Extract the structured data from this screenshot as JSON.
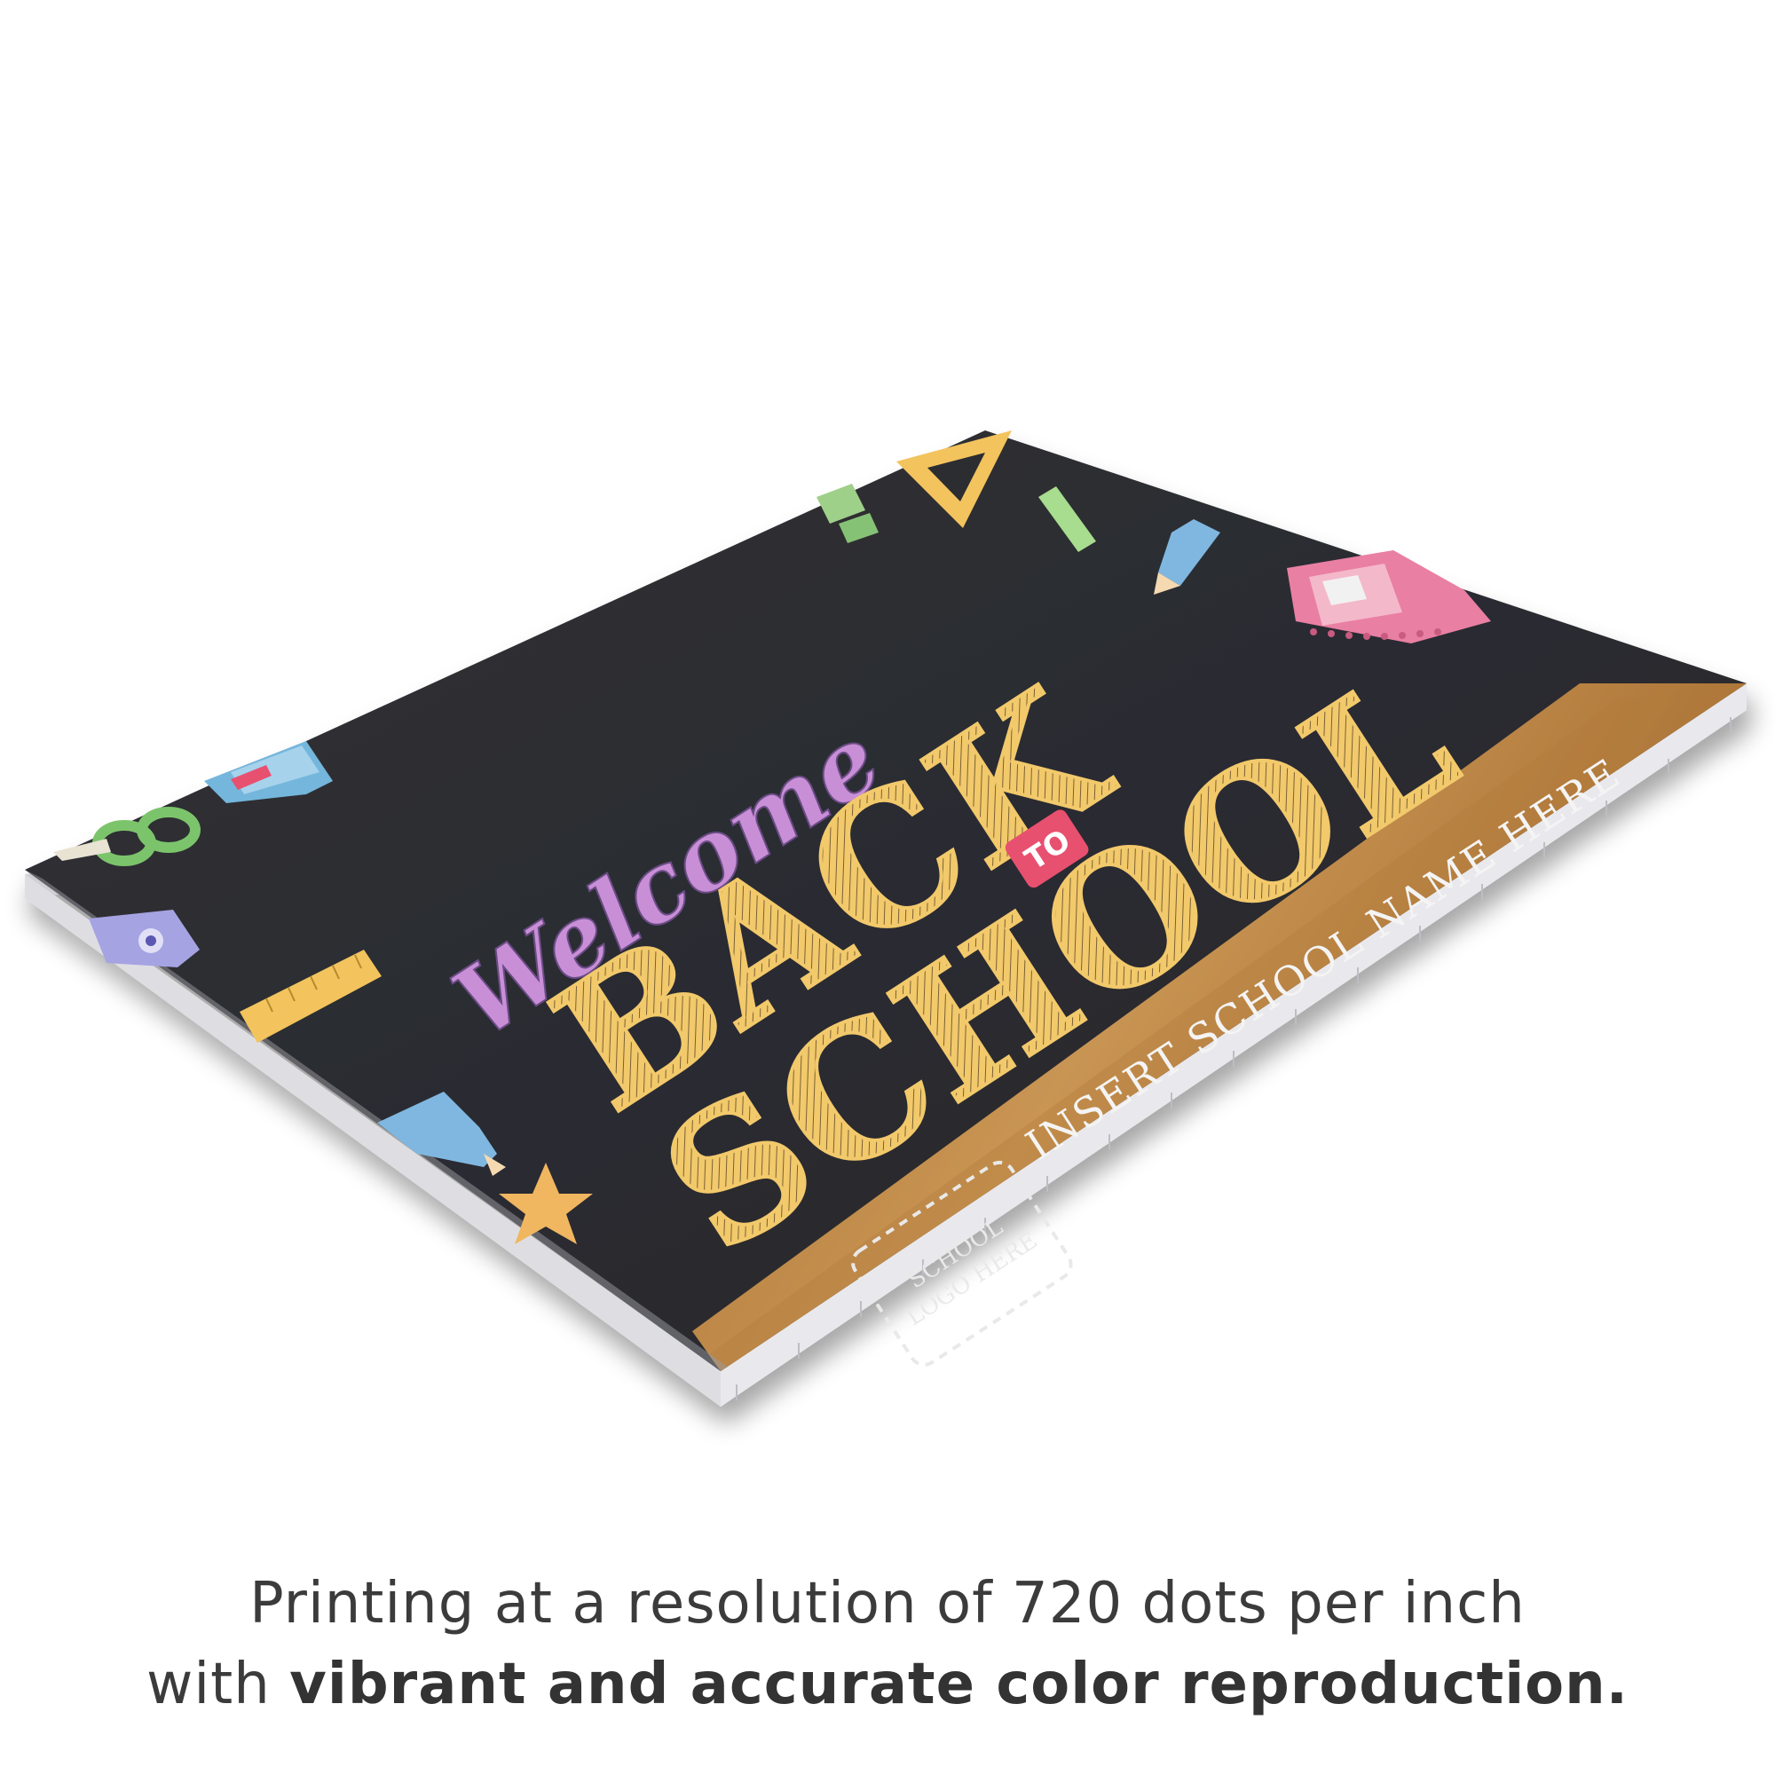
{
  "sign": {
    "welcome_text": "Welcome",
    "back_text": "BACK",
    "to_text": "TO",
    "school_text": "SCHOOL",
    "school_name_text": "INSERT SCHOOL NAME HERE",
    "logo_line1": "SCHOOL",
    "logo_line2": "LOGO HERE"
  },
  "caption": {
    "line1": "Printing at a resolution of 720 dots per inch",
    "line2_prefix": "with ",
    "line2_bold": "vibrant and accurate color reproduction."
  },
  "colors": {
    "chalkboard": "#2c2d31",
    "chalk_yellow": "#f2c96b",
    "wood": "#b5803f",
    "to_badge": "#e8506f",
    "text_gray": "#3b3b3b"
  }
}
